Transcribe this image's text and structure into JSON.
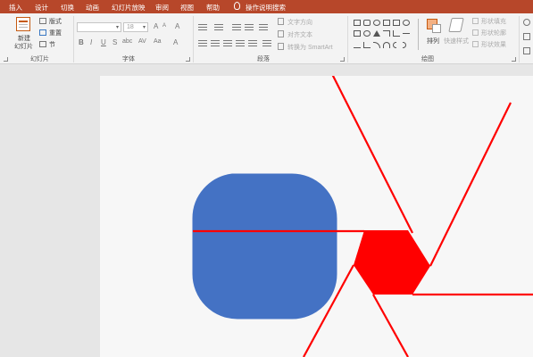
{
  "tabs": [
    "插入",
    "设计",
    "切换",
    "动画",
    "幻灯片放映",
    "审阅",
    "视图",
    "帮助",
    "操作说明搜索"
  ],
  "slides_group": {
    "new_slide": [
      "新建",
      "幻灯片"
    ],
    "layout": "版式",
    "reset": "重置",
    "section": "节",
    "label": "幻灯片"
  },
  "font_group": {
    "font_name_value": "",
    "font_size_value": "18",
    "bold": "B",
    "italic": "I",
    "underline": "U",
    "strike": "S",
    "shadow": "abc",
    "spacing": "AV",
    "case": "Aa",
    "grow": "A",
    "shrink": "A",
    "clear": "A",
    "color": "A",
    "label": "字体"
  },
  "paragraph_group": {
    "text_direction": "文字方向",
    "align_text": "对齐文本",
    "convert_smartart": "转换为 SmartArt",
    "label": "段落"
  },
  "drawing_group": {
    "arrange": "排列",
    "quick_styles": "快速样式",
    "shape_fill": "形状填充",
    "shape_outline": "形状轮廓",
    "shape_effects": "形状效果",
    "label": "绘图"
  },
  "colors": {
    "tab_bar": "#b7472a",
    "shape_blue": "#4472c4",
    "line_red": "#ff0000"
  }
}
